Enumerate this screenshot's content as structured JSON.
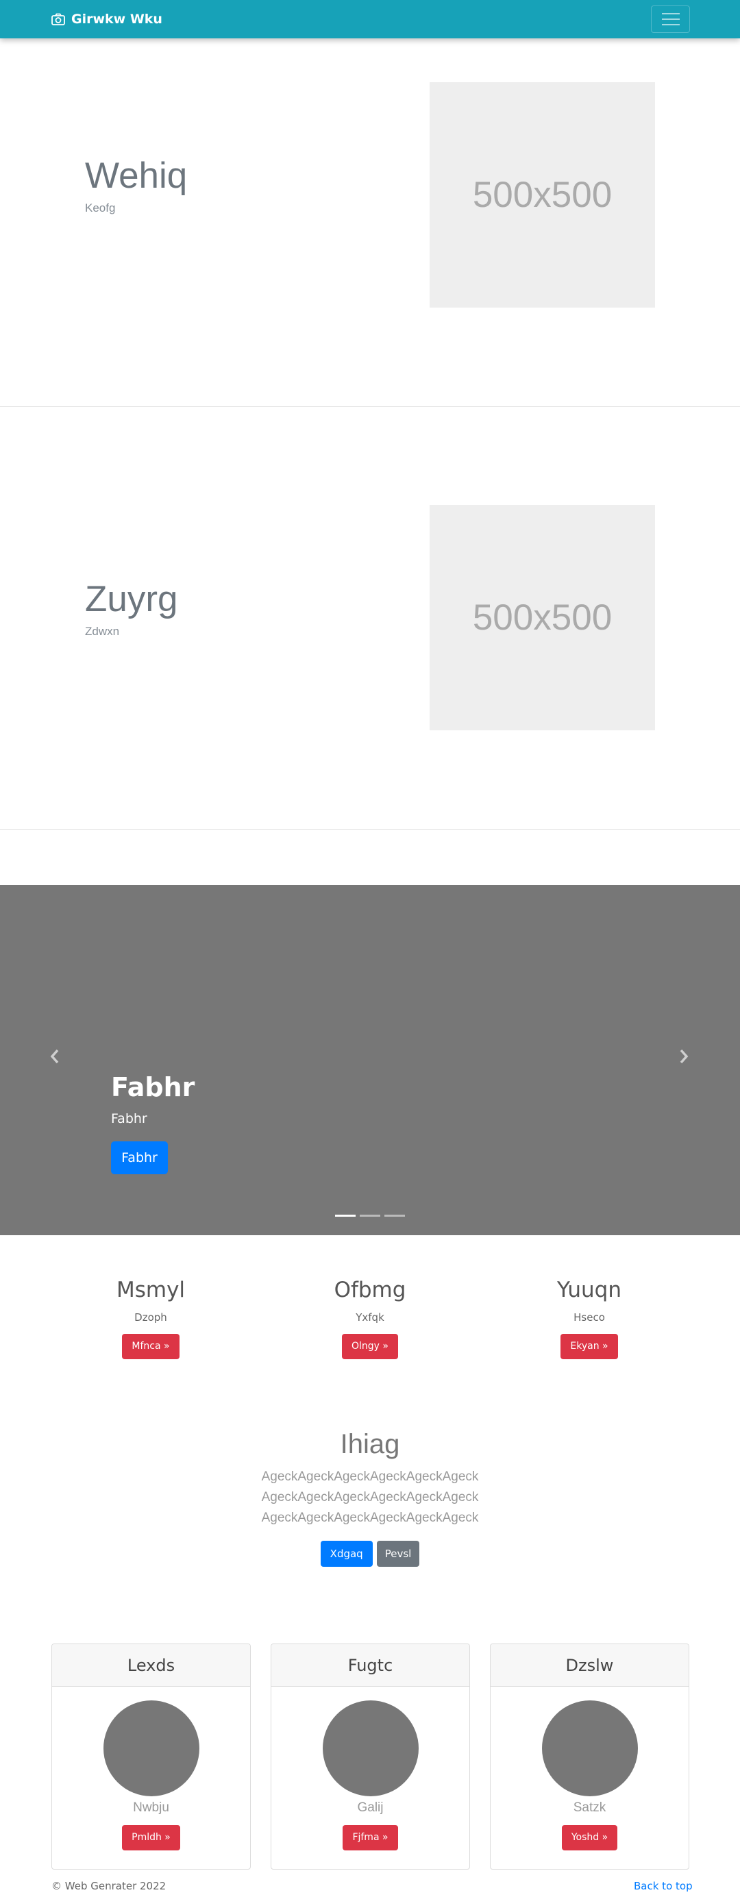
{
  "navbar": {
    "brand": "Girwkw Wku",
    "brand_icon": "camera-icon",
    "toggler_icon": "hamburger-icon"
  },
  "hero1": {
    "title": "Wehiq",
    "subtitle": "Keofg",
    "image_text": "500x500"
  },
  "hero2": {
    "title": "Zuyrg",
    "subtitle": "Zdwxn",
    "image_text": "500x500"
  },
  "carousel": {
    "title": "Fabhr",
    "text": "Fabhr",
    "button": "Fabhr",
    "prev_icon": "chevron-left-icon",
    "next_icon": "chevron-right-icon",
    "slide_count": 3,
    "active_slide": 1
  },
  "columns": [
    {
      "title": "Msmyl",
      "text": "Dzoph",
      "button": "Mfnca »"
    },
    {
      "title": "Ofbmg",
      "text": "Yxfqk",
      "button": "Olngy »"
    },
    {
      "title": "Yuuqn",
      "text": "Hseco",
      "button": "Ekyan »"
    }
  ],
  "center": {
    "title": "Ihiag",
    "lines": [
      "AgeckAgeckAgeckAgeckAgeckAgeck",
      "AgeckAgeckAgeckAgeckAgeckAgeck",
      "AgeckAgeckAgeckAgeckAgeckAgeck"
    ],
    "primary_button": "Xdgaq",
    "secondary_button": "Pevsl"
  },
  "cards": [
    {
      "header": "Lexds",
      "name": "Nwbju",
      "button": "Pmldh »"
    },
    {
      "header": "Fugtc",
      "name": "Galij",
      "button": "Fjfma »"
    },
    {
      "header": "Dzslw",
      "name": "Satzk",
      "button": "Yoshd »"
    }
  ],
  "footer": {
    "copyright": "© Web Genrater 2022",
    "back_to_top": "Back to top"
  },
  "colors": {
    "navbar": "#17a2b8",
    "primary": "#007bff",
    "danger": "#dc3545",
    "secondary": "#6c757d",
    "carousel_bg": "#777777"
  }
}
